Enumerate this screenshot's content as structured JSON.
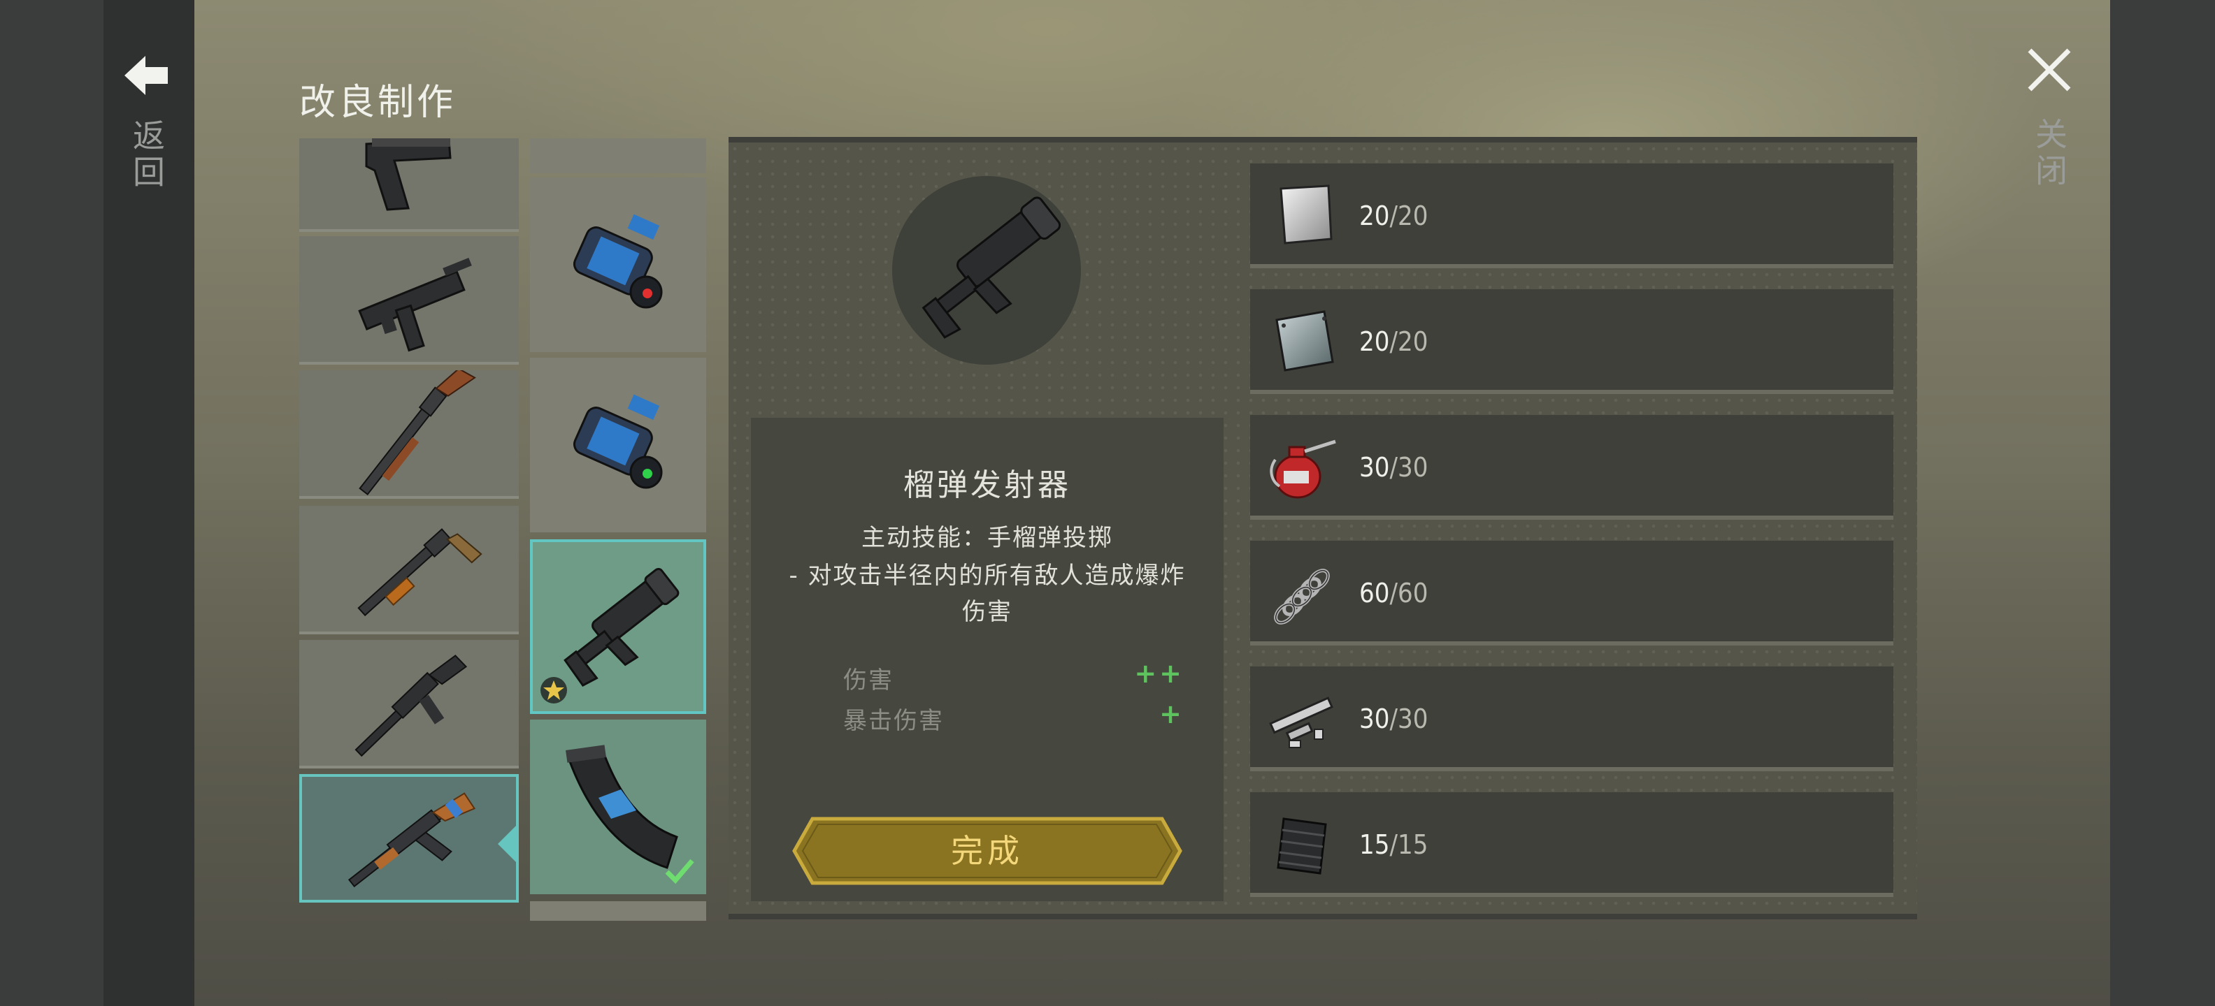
{
  "header": {
    "title": "改良制作",
    "back_label": "返回",
    "close_label": "关闭"
  },
  "weapons": [
    {
      "name": "pistol-icon"
    },
    {
      "name": "smg-icon"
    },
    {
      "name": "lever-shotgun-icon"
    },
    {
      "name": "pump-shotgun-icon"
    },
    {
      "name": "rifle-icon"
    },
    {
      "name": "assault-rifle-icon",
      "selected": true
    }
  ],
  "mods": [
    {
      "name": "red-dot-sight-icon"
    },
    {
      "name": "green-dot-sight-icon"
    },
    {
      "name": "grenade-launcher-icon",
      "selected": true
    },
    {
      "name": "magazine-icon",
      "completed": true
    }
  ],
  "detail": {
    "item_name": "榴弹发射器",
    "skill_line1": "主动技能：手榴弹投掷",
    "skill_line2": "- 对攻击半径内的所有敌人造成爆炸",
    "skill_line3": "伤害",
    "stats": [
      {
        "label": "伤害",
        "value": "++"
      },
      {
        "label": "暴击伤害",
        "value": "+"
      }
    ],
    "confirm_label": "完成"
  },
  "materials": [
    {
      "icon": "metal-plate-icon",
      "have": "20",
      "need": "/20"
    },
    {
      "icon": "steel-plate-icon",
      "have": "20",
      "need": "/20"
    },
    {
      "icon": "oil-can-icon",
      "have": "30",
      "need": "/30"
    },
    {
      "icon": "spring-icon",
      "have": "60",
      "need": "/60"
    },
    {
      "icon": "pipe-parts-icon",
      "have": "30",
      "need": "/30"
    },
    {
      "icon": "rubber-sheet-icon",
      "have": "15",
      "need": "/15"
    }
  ],
  "colors": {
    "selected_border": "#67c5c0",
    "stat_plus": "#5ec25e",
    "confirm_text": "#f3d77a",
    "confirm_fill": "#8a7421"
  }
}
